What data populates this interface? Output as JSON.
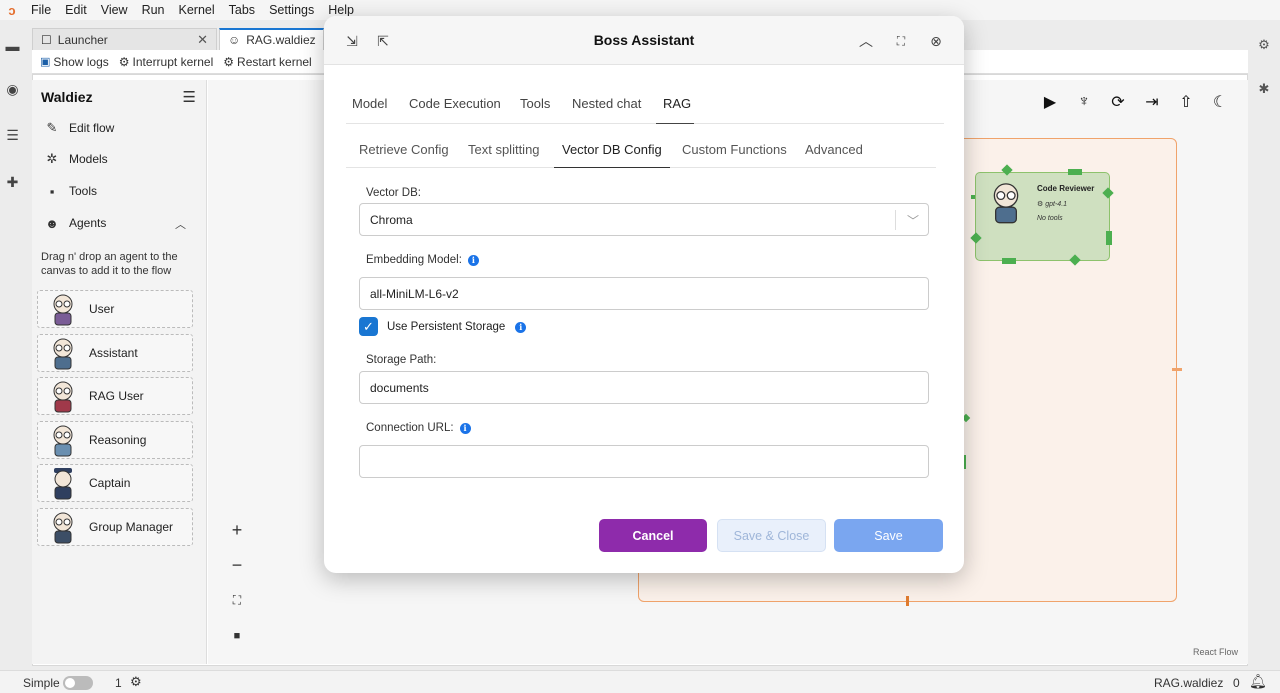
{
  "menubar": {
    "items": [
      "File",
      "Edit",
      "View",
      "Run",
      "Kernel",
      "Tabs",
      "Settings",
      "Help"
    ]
  },
  "tabs": [
    {
      "label": "Launcher",
      "icon": "external-link-icon"
    },
    {
      "label": "RAG.waldiez",
      "icon": "robot-icon"
    }
  ],
  "toolbar": {
    "show_logs": "Show logs",
    "interrupt": "Interrupt kernel",
    "restart": "Restart kernel"
  },
  "sidebar": {
    "title": "Waldiez",
    "items": [
      {
        "label": "Edit flow",
        "icon": "pencil-icon"
      },
      {
        "label": "Models",
        "icon": "openai-icon"
      },
      {
        "label": "Tools",
        "icon": "terminal-icon"
      },
      {
        "label": "Agents",
        "icon": "robot-icon"
      }
    ],
    "hint": "Drag n' drop an agent to the canvas to add it to the flow",
    "agents": [
      {
        "label": "User"
      },
      {
        "label": "Assistant"
      },
      {
        "label": "RAG User"
      },
      {
        "label": "Reasoning"
      },
      {
        "label": "Captain"
      },
      {
        "label": "Group Manager"
      }
    ]
  },
  "canvas": {
    "node": {
      "title": "Code Reviewer",
      "model": "gpt-4.1",
      "tools": "No tools"
    },
    "attribution": "React Flow"
  },
  "modal": {
    "title": "Boss Assistant",
    "tabs": [
      "Model",
      "Code Execution",
      "Tools",
      "Nested chat",
      "RAG"
    ],
    "active_tab": "RAG",
    "subtabs": [
      "Retrieve Config",
      "Text splitting",
      "Vector DB Config",
      "Custom Functions",
      "Advanced"
    ],
    "active_subtab": "Vector DB Config",
    "vector_db_label": "Vector DB:",
    "vector_db_value": "Chroma",
    "embedding_label": "Embedding Model:",
    "embedding_value": "all-MiniLM-L6-v2",
    "persistent_label": "Use Persistent Storage",
    "persistent_checked": true,
    "storage_label": "Storage Path:",
    "storage_value": "documents",
    "connection_label": "Connection URL:",
    "connection_value": "",
    "cancel": "Cancel",
    "save_close": "Save & Close",
    "save": "Save"
  },
  "statusbar": {
    "mode": "Simple",
    "kernels": "1",
    "file": "RAG.waldiez",
    "notifications": "0"
  },
  "colors": {
    "accent": "#1976d2",
    "cancel": "#8e2bab",
    "save": "#7aa6f0",
    "group_border": "#f0a36b",
    "node_fill": "#cfe0c0",
    "handle": "#4caf50"
  }
}
